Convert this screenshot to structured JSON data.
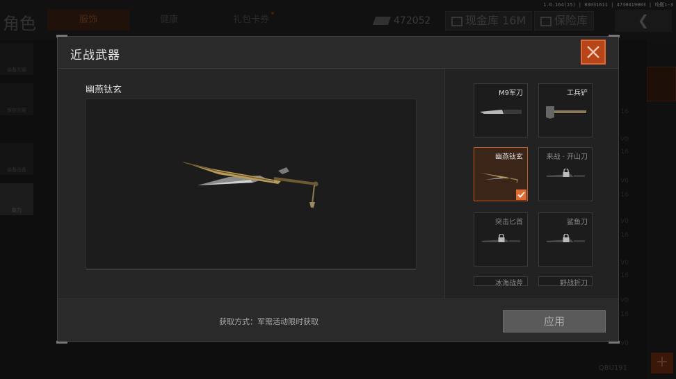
{
  "background": {
    "page_title": "角色",
    "tabs": [
      {
        "label": "服饰",
        "active": true
      },
      {
        "label": "健康",
        "active": false
      },
      {
        "label": "礼包卡券",
        "active": false
      }
    ],
    "currency_value": "472052",
    "cash_vault_label": "现金库 16M",
    "insurance_vault_label": "保险库",
    "version_text": "1.0.164(15) | 03031611 | 4730419003 | 均衡1-3",
    "left_menu": [
      "装备方案",
      "保存方案",
      "装备战备",
      "能力"
    ],
    "right_values": [
      "16",
      "V0",
      "16",
      "V0",
      "16",
      "V0",
      "16",
      "V0",
      "16",
      "V0",
      "16",
      "V0"
    ],
    "bottom_weapon": "QBU191",
    "add_button": "+"
  },
  "modal": {
    "title": "近战武器",
    "selected_weapon_name": "幽燕钛玄",
    "weapons": [
      {
        "name": "M9军刀",
        "locked": false,
        "selected": false
      },
      {
        "name": "工兵铲",
        "locked": false,
        "selected": false
      },
      {
        "name": "幽燕钛玄",
        "locked": false,
        "selected": true
      },
      {
        "name": "来战 · 开山刀",
        "locked": true,
        "selected": false
      },
      {
        "name": "突击匕首",
        "locked": true,
        "selected": false
      },
      {
        "name": "鲨鱼刀",
        "locked": true,
        "selected": false
      },
      {
        "name": "冰海战斧",
        "locked": true,
        "selected": false
      },
      {
        "name": "野战折刀",
        "locked": true,
        "selected": false
      }
    ],
    "obtain_text": "获取方式：军需活动限时获取",
    "apply_label": "应用"
  },
  "colors": {
    "accent": "#e06a30",
    "close_bg": "#b8451a",
    "modal_bg": "#262626"
  }
}
